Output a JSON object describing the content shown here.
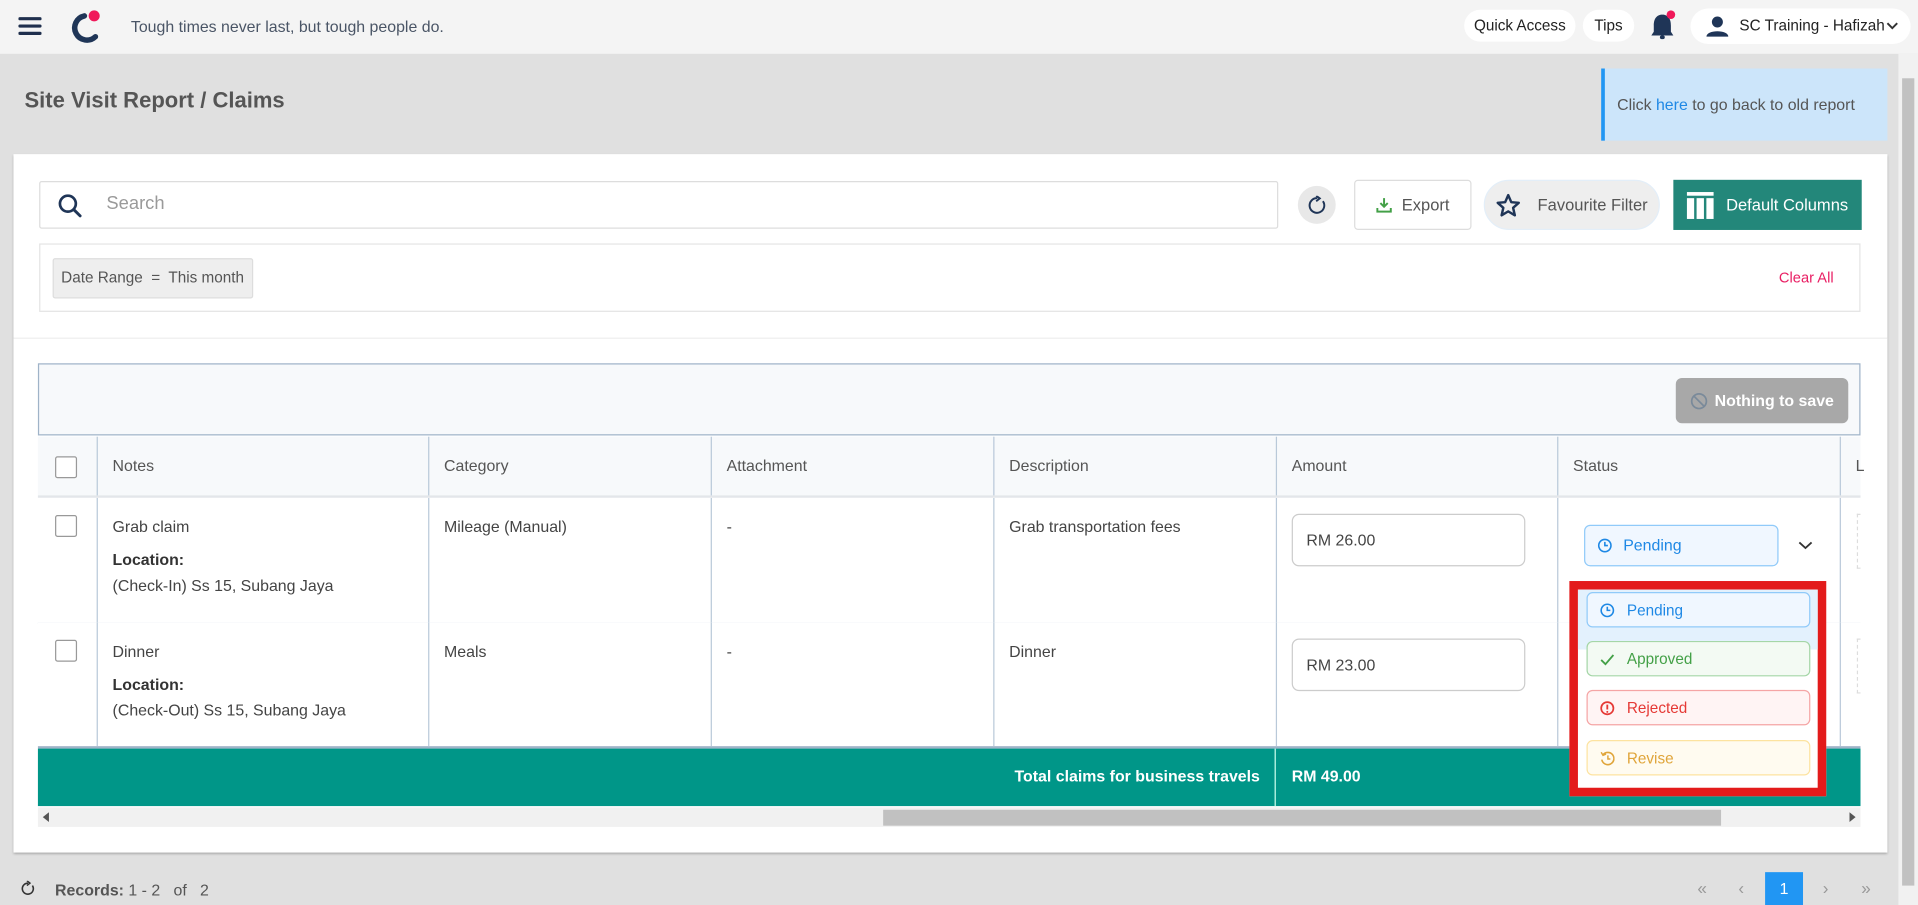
{
  "topbar": {
    "tagline": "Tough times never last, but tough people do.",
    "quick_access": "Quick Access",
    "tips": "Tips",
    "user": "SC Training - Hafizah",
    "notification_color": "#f0185a"
  },
  "page": {
    "title": "Site Visit Report / Claims",
    "info_prefix": "Click ",
    "info_link": "here",
    "info_suffix": " to go back to old report"
  },
  "toolbar": {
    "search_placeholder": "Search",
    "export": "Export",
    "favourite_filter": "Favourite Filter",
    "default_columns": "Default Columns"
  },
  "filters": {
    "chip": "Date Range  =  This month",
    "clear_all": "Clear All"
  },
  "table": {
    "save_button": "Nothing to save",
    "columns": [
      "Notes",
      "Category",
      "Attachment",
      "Description",
      "Amount",
      "Status",
      "L"
    ],
    "location_label": "Location:",
    "rows": [
      {
        "notes": "Grab claim",
        "location": "(Check-In) Ss 15, Subang Jaya",
        "category": "Mileage (Manual)",
        "attachment": "-",
        "description": "Grab transportation fees",
        "amount": "RM 26.00",
        "status": "Pending"
      },
      {
        "notes": "Dinner",
        "location": "(Check-Out) Ss 15, Subang Jaya",
        "category": "Meals",
        "attachment": "-",
        "description": "Dinner",
        "amount": "RM 23.00",
        "status": ""
      }
    ],
    "footer_label": "Total claims for business travels",
    "footer_total": "RM 49.00"
  },
  "status_dropdown": {
    "options": [
      "Pending",
      "Approved",
      "Rejected",
      "Revise"
    ]
  },
  "pagination": {
    "records_label": "Records:",
    "range": "1 - 2",
    "of": "of",
    "total": "2",
    "current": "1",
    "first": "«",
    "prev": "‹",
    "next": "›",
    "last": "»"
  },
  "colors": {
    "teal": "#009688",
    "accent_blue": "#2196f3",
    "highlight": "#e31b1b"
  }
}
